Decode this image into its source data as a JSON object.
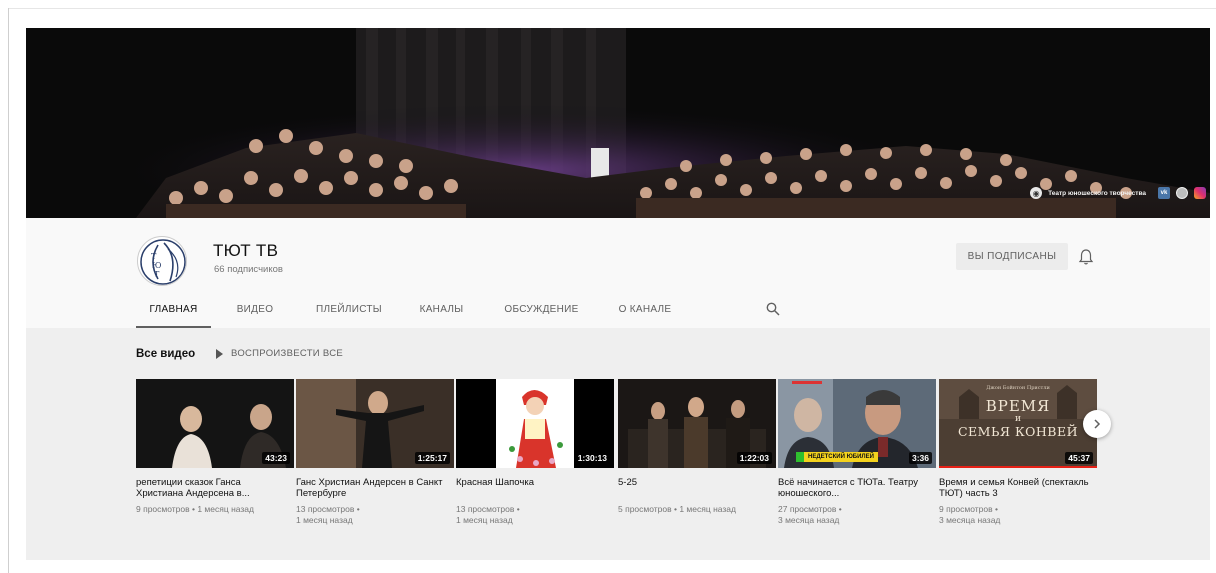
{
  "banner": {
    "link_text": "Театр юношеского творчества",
    "links": [
      "vk-icon",
      "globe-icon",
      "instagram-icon"
    ]
  },
  "channel": {
    "name": "ТЮТ ТВ",
    "subscribers": "66 подписчиков",
    "subscribe_button": "ВЫ ПОДПИСАНЫ",
    "avatar_icon": "theatre-logo-icon"
  },
  "tabs": [
    {
      "label": "ГЛАВНАЯ",
      "active": true
    },
    {
      "label": "ВИДЕО"
    },
    {
      "label": "ПЛЕЙЛИСТЫ"
    },
    {
      "label": "КАНАЛЫ"
    },
    {
      "label": "ОБСУЖДЕНИЕ"
    },
    {
      "label": "О КАНАЛЕ"
    }
  ],
  "shelf": {
    "title": "Все видео",
    "play_all": "ВОСПРОИЗВЕСТИ ВСЕ"
  },
  "videos": [
    {
      "title": "репетиции сказок Ганса Христиана Андерсена в...",
      "duration": "43:23",
      "meta1": "9 просмотров • 1 месяц назад",
      "meta2": ""
    },
    {
      "title": "Ганс Христиан Андерсен в Санкт Петербурге",
      "duration": "1:25:17",
      "meta1": "13 просмотров •",
      "meta2": "1 месяц назад"
    },
    {
      "title": "Красная Шапочка",
      "duration": "1:30:13",
      "meta1": "13 просмотров •",
      "meta2": "1 месяц назад"
    },
    {
      "title": "5-25",
      "duration": "1:22:03",
      "meta1": "5 просмотров • 1 месяц назад",
      "meta2": ""
    },
    {
      "title": "Всё начинается с ТЮТа. Театру юношеского...",
      "duration": "3:36",
      "thumb_caption": "НЕДЕТСКИЙ ЮБИЛЕЙ",
      "meta1": "27 просмотров •",
      "meta2": "3 месяца назад"
    },
    {
      "title": "Время и семья Конвей (спектакль ТЮТ) часть 3",
      "duration": "45:37",
      "thumb_text": [
        "ВРЕМЯ",
        "и",
        "СЕМЬЯ КОНВЕЙ"
      ],
      "thumb_author": "Джон Бойнтон Пристли",
      "meta1": "9 просмотров •",
      "meta2": "3 месяца назад"
    }
  ],
  "colors": {
    "header_bg": "#f9f9f9",
    "content_bg": "#efefef",
    "button_bg": "#ececec",
    "text_secondary": "#606060",
    "news_green": "#2fbf2f",
    "news_yellow": "#f4d21d"
  }
}
